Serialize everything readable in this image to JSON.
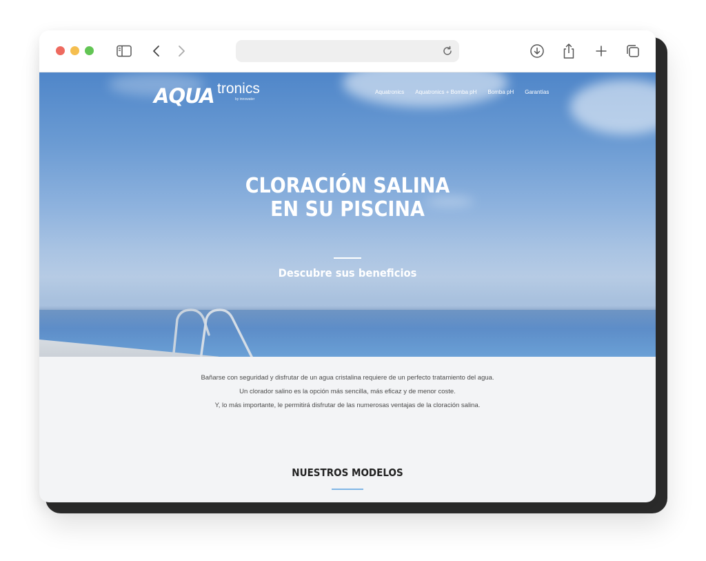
{
  "browser": {
    "traffic_lights": {
      "close": "#ee6a5f",
      "minimize": "#f5be4f",
      "zoom": "#62c554"
    },
    "icons": [
      "sidebar-icon",
      "back-icon",
      "forward-icon",
      "reload-icon",
      "download-icon",
      "share-icon",
      "new-tab-icon",
      "tabs-overview-icon"
    ],
    "address": {
      "value": ""
    }
  },
  "site": {
    "logo": {
      "primary": "AQUA",
      "secondary": "tronics",
      "tagline": "by innowater"
    },
    "nav": [
      "Aquatronics",
      "Aquatronics + Bomba pH",
      "Bomba pH",
      "Garantías"
    ],
    "hero": {
      "title_line1": "CLORACIÓN SALINA",
      "title_line2": "EN SU PISCINA",
      "subtitle": "Descubre sus beneficios"
    },
    "intro": [
      "Bañarse con seguridad y disfrutar de un agua cristalina requiere de un perfecto tratamiento del agua.",
      "Un clorador salino es la opción más sencilla, más eficaz y de menor coste.",
      "Y, lo más importante, le permitirá disfrutar de las numerosas ventajas de la cloración salina."
    ],
    "section": {
      "title": "NUESTROS MODELOS"
    },
    "colors": {
      "accent_rule": "#7fb6e6",
      "hero_text": "#ffffff",
      "body_text": "#4a4a4a",
      "page_bg": "#f3f4f6"
    }
  }
}
